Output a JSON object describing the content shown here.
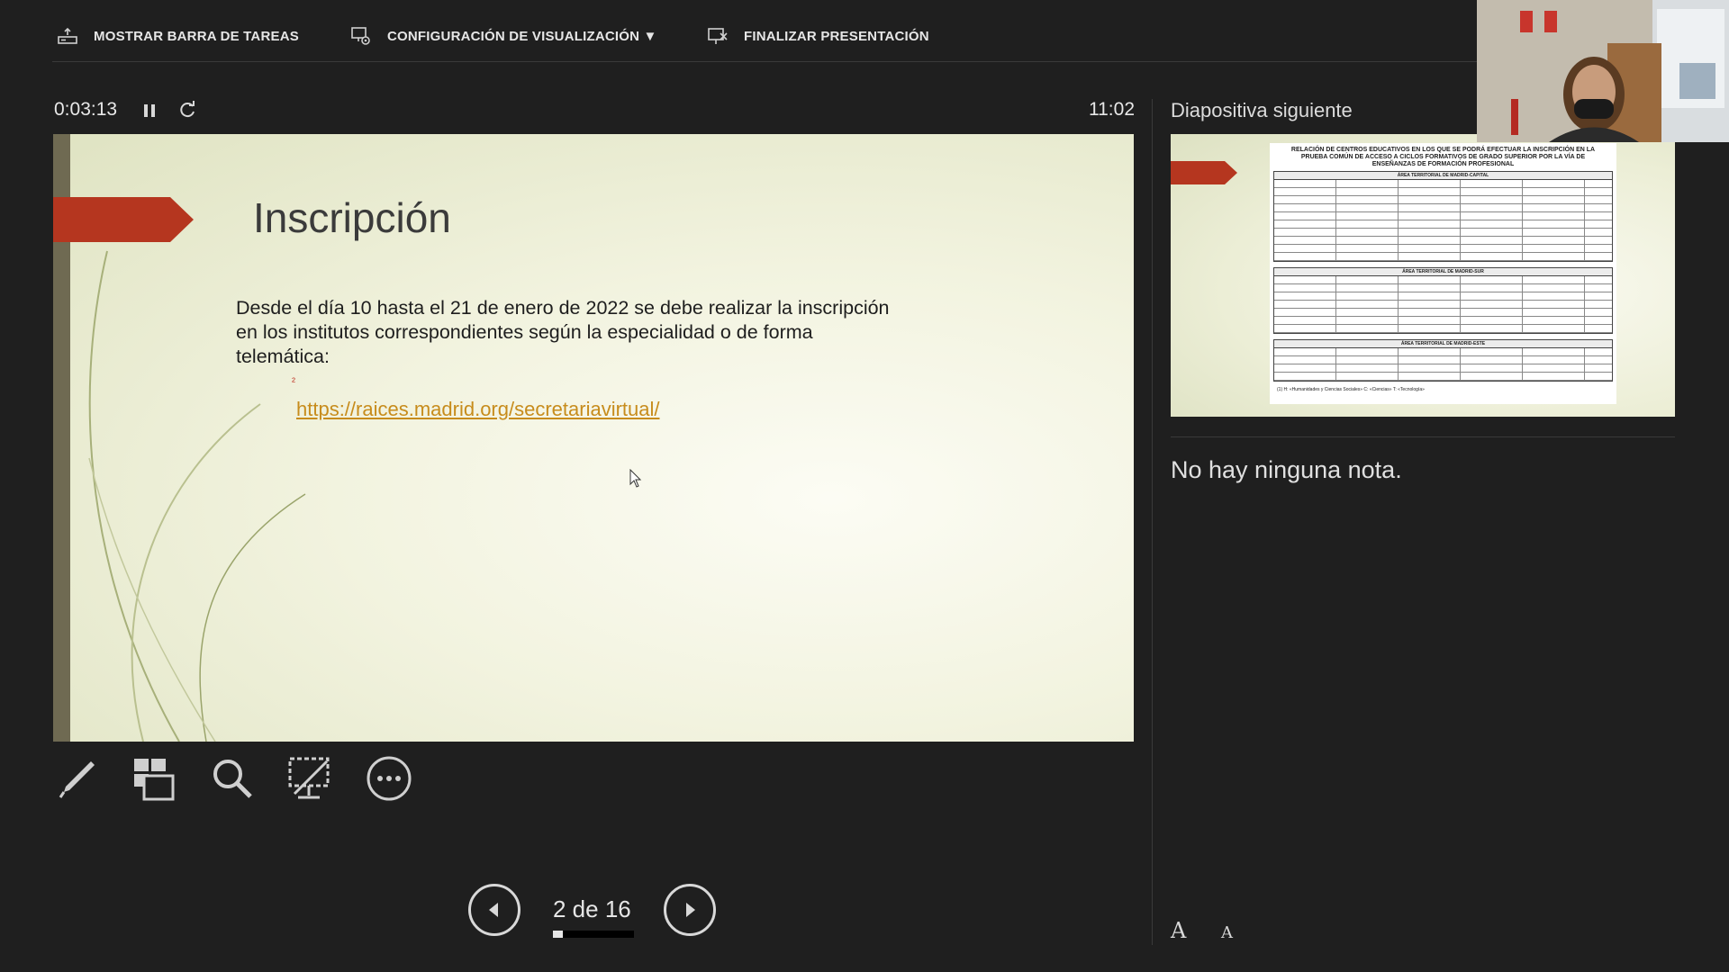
{
  "toolbar": {
    "show_taskbar": "MOSTRAR BARRA DE TAREAS",
    "display_settings": "CONFIGURACIÓN DE VISUALIZACIÓN ▼",
    "end_show": "FINALIZAR PRESENTACIÓN"
  },
  "presenter": {
    "elapsed": "0:03:13",
    "clock": "11:02"
  },
  "slide": {
    "title": "Inscripción",
    "body": "Desde el día 10  hasta el 21 de enero de 2022 se debe realizar la inscripción en los institutos correspondientes según la especialidad o de forma telemática:",
    "mark": "²",
    "link": "https://raices.madrid.org/secretariavirtual/"
  },
  "navigation": {
    "page_indicator": "2 de 16",
    "progress_fraction": 0.125
  },
  "next_slide": {
    "label": "Diapositiva siguiente",
    "doc_title": "RELACIÓN DE CENTROS EDUCATIVOS EN LOS QUE SE PODRÁ EFECTUAR LA INSCRIPCIÓN EN LA PRUEBA COMÚN DE ACCESO A CICLOS FORMATIVOS DE GRADO SUPERIOR POR LA VÍA DE ENSEÑANZAS DE FORMACIÓN PROFESIONAL",
    "area_1": "ÁREA TERRITORIAL DE MADRID-CAPITAL",
    "area_2": "ÁREA TERRITORIAL DE MADRID-SUR",
    "area_3": "ÁREA TERRITORIAL DE MADRID-ESTE",
    "footnote": "(1) H: «Humanidades y Ciencias Sociales»     C: «Ciencias»     T: «Tecnología»"
  },
  "notes": {
    "text": "No hay ninguna nota."
  },
  "font_controls": {
    "increase": "A",
    "decrease": "A"
  },
  "colors": {
    "accent_arrow": "#b5361f",
    "link": "#c78c1c",
    "background": "#1f1f1f"
  },
  "icons": {
    "show_taskbar": "taskbar-icon",
    "display_settings": "monitor-gear-icon",
    "end_show": "end-slideshow-icon",
    "pause": "pause-icon",
    "reset": "refresh-icon",
    "pen": "pen-icon",
    "slides_grid": "slide-grid-icon",
    "zoom": "magnifier-icon",
    "black_screen": "black-screen-icon",
    "more": "more-options-icon",
    "prev": "previous-arrow-icon",
    "next": "next-arrow-icon"
  }
}
